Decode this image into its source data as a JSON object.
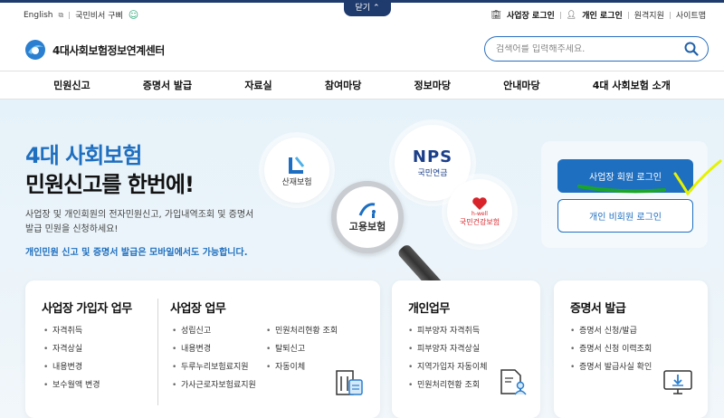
{
  "topbar": {
    "english": "English",
    "sinmungo": "국민비서 구삐",
    "close_tab": "닫기",
    "biz_login": "사업장 로그인",
    "personal_login": "개인 로그인",
    "remote_support": "원격지원",
    "sitemap": "사이트맵"
  },
  "header": {
    "logo_text": "4대사회보험정보연계센터",
    "search_placeholder": "검색어를 입력해주세요."
  },
  "nav": {
    "items": [
      "민원신고",
      "증명서 발급",
      "자료실",
      "참여마당",
      "정보마당",
      "안내마당",
      "4대 사회보험 소개"
    ]
  },
  "hero": {
    "title_line1": "4대 사회보험",
    "title_line2": "민원신고를 한번에!",
    "desc": "사업장 및 개인회원의 전자민원신고, 가입내역조회 및 증명서 발급 민원을 신청하세요!",
    "note": "개인민원 신고 및 증명서 발급은 모바일에서도 가능합니다.",
    "bubbles": {
      "sanjae": "산재보험",
      "nps_logo": "NPS",
      "nps": "국민연금",
      "employment": "고용보험",
      "nhis_logo": "h-well",
      "nhis": "국민건강보험"
    }
  },
  "login": {
    "biz_member": "사업장 회원 로그인",
    "non_member": "개인 비회원 로그인"
  },
  "cards": {
    "biz_subscriber": {
      "title": "사업장 가입자 업무",
      "items": [
        "자격취득",
        "자격상실",
        "내용변경",
        "보수월액 변경"
      ]
    },
    "biz_work": {
      "title": "사업장 업무",
      "col1": [
        "성립신고",
        "내용변경",
        "두루누리보험료지원",
        "가사근로자보험료지원"
      ],
      "col2": [
        "민원처리현황 조회",
        "탈퇴신고",
        "자동이체"
      ]
    },
    "personal": {
      "title": "개인업무",
      "items": [
        "피부양자 자격취득",
        "피부양자 자격상실",
        "지역가입자 자동이체",
        "민원처리현황 조회"
      ]
    },
    "certificate": {
      "title": "증명서 발급",
      "items": [
        "증명서 신청/발급",
        "증명서 신청 이력조회",
        "증명서 발급사실 확인"
      ]
    }
  },
  "colors": {
    "brand_blue": "#1f6fc0",
    "navy": "#1f3b6e",
    "highlight_green": "#1aa52a",
    "highlight_yellow": "#e5f200"
  }
}
